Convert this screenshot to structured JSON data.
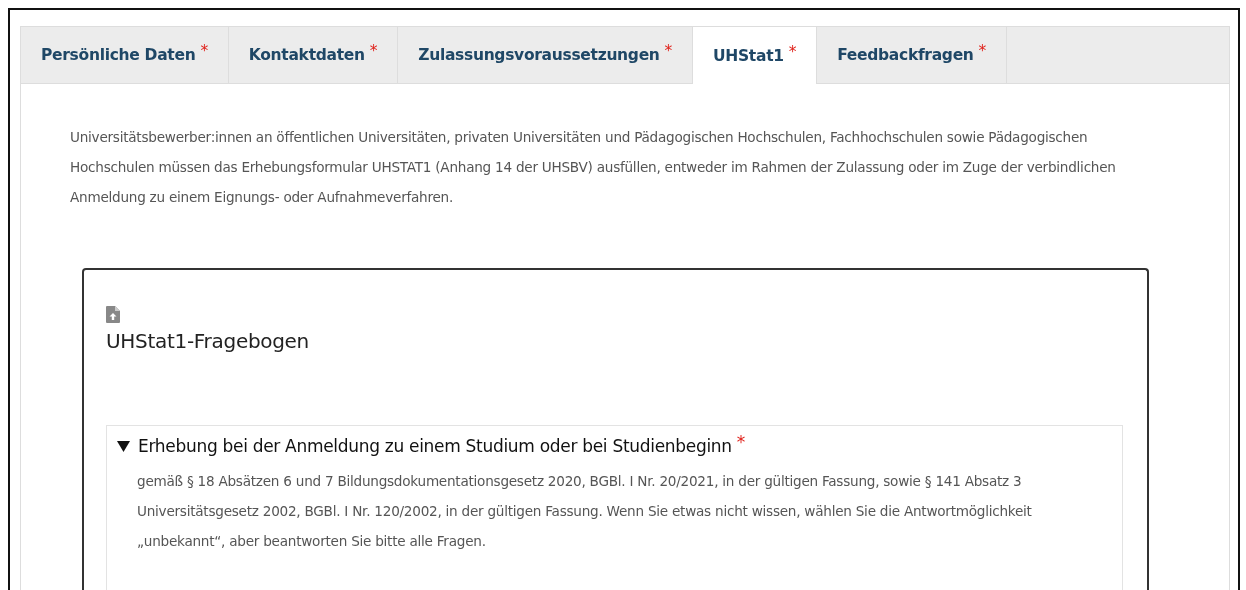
{
  "tabs": [
    {
      "label": "Persönliche Daten",
      "required_mark": "*",
      "selected": false
    },
    {
      "label": "Kontaktdaten",
      "required_mark": "*",
      "selected": false
    },
    {
      "label": "Zulassungsvoraussetzungen",
      "required_mark": "*",
      "selected": false
    },
    {
      "label": "UHStat1",
      "required_mark": "*",
      "selected": true
    },
    {
      "label": "Feedbackfragen",
      "required_mark": "*",
      "selected": false
    }
  ],
  "intro": "Universitätsbewerber:innen an öffentlichen Universitäten, privaten Universitäten und Pädagogischen Hochschulen, Fachhochschulen sowie Pädagogischen Hochschulen müssen das Erhebungsformular UHSTAT1 (Anhang 14 der UHSBV) ausfüllen, entweder im Rahmen der Zulassung oder im Zuge der verbindlichen Anmeldung zu einem Eignungs- oder Aufnahmeverfahren.",
  "card": {
    "title": "UHStat1-Fragebogen",
    "section": {
      "title": "Erhebung bei der Anmeldung zu einem Studium oder bei Studienbeginn",
      "required_mark": "*",
      "expanded": true,
      "text": "gemäß § 18 Absätzen 6 und 7 Bildungsdokumentationsgesetz 2020, BGBl. I   Nr. 20/2021, in der gültigen Fassung, sowie § 141 Absatz 3 Universitätsgesetz 2002, BGBl. I   Nr. 120/2002, in der gültigen Fassung. Wenn Sie etwas nicht wissen, wählen Sie die Antwortmöglichkeit „unbekannt“, aber beantworten Sie bitte alle Fragen."
    }
  }
}
